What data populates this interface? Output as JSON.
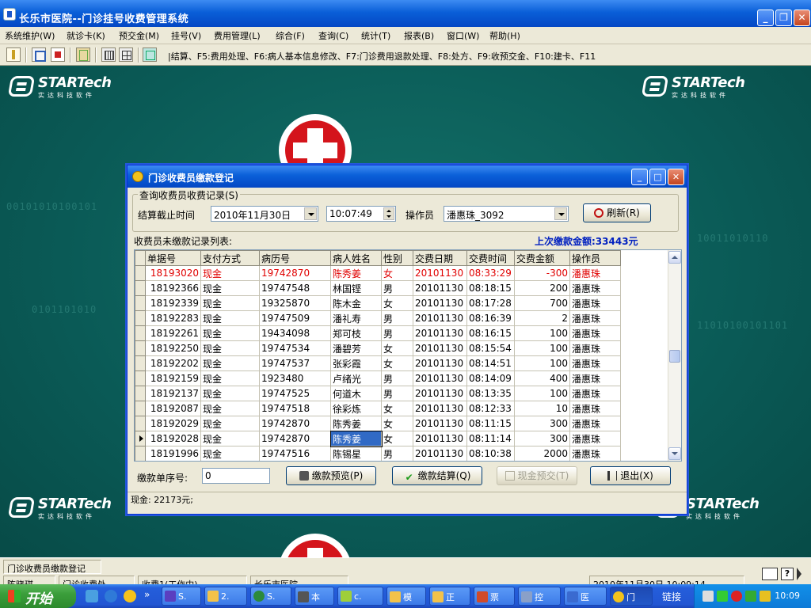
{
  "app": {
    "title": "长乐市医院--门诊挂号收费管理系统",
    "min_label": "_",
    "max_label": "❐",
    "close_label": "✕"
  },
  "menu": [
    "系统维护(W)",
    "就诊卡(K)",
    "预交金(M)",
    "挂号(V)",
    "费用管理(L)",
    "综合(F)",
    "查询(C)",
    "统计(T)",
    "报表(B)",
    "窗口(W)",
    "帮助(H)"
  ],
  "toolbar": {
    "hint": "|结算、F5:费用处理、F6:病人基本信息修改、F7:门诊费用退款处理、F8:处方、F9:收预交金、F10:建卡、F11"
  },
  "brand": {
    "name": "STARTech",
    "subtitle": "实达科技软件"
  },
  "background": {
    "binary_line_1": "00101010100101",
    "binary_line_2": "0101101010",
    "binary_line_3": "10011010110",
    "binary_line_4": "11010100101101"
  },
  "dialog": {
    "title": "门诊收费员缴款登记",
    "min_label": "_",
    "max_label": "□",
    "close_label": "✕",
    "query_group_label": "查询收费员收费记录(S)",
    "cutoff_label": "结算截止时间",
    "cutoff_date": "2010年11月30日",
    "cutoff_time": "10:07:49",
    "operator_label": "操作员",
    "operator_value": "潘惠珠_3092",
    "refresh_label": "刷新(R)",
    "list_label": "收费员未缴款记录列表:",
    "last_payment_label": "上次缴款金额:33443元",
    "payment_no_label": "缴款单序号:",
    "payment_no_value": "0",
    "preview_button": "缴款预览(P)",
    "settle_button": "缴款结算(Q)",
    "cash_preview_button": "现金预交(T)",
    "exit_button": "退出(X)",
    "summary": "现金: 22173元;"
  },
  "grid": {
    "columns": [
      "单据号",
      "支付方式",
      "病历号",
      "病人姓名",
      "性别",
      "交费日期",
      "交费时间",
      "交费金额",
      "操作员"
    ],
    "rows": [
      [
        "18193020",
        "现金",
        "19742870",
        "陈秀姜",
        "女",
        "20101130",
        "08:33:29",
        "-300",
        "潘惠珠"
      ],
      [
        "18192366",
        "现金",
        "19747548",
        "林国铿",
        "男",
        "20101130",
        "08:18:15",
        "200",
        "潘惠珠"
      ],
      [
        "18192339",
        "现金",
        "19325870",
        "陈木金",
        "女",
        "20101130",
        "08:17:28",
        "700",
        "潘惠珠"
      ],
      [
        "18192283",
        "现金",
        "19747509",
        "潘礼寿",
        "男",
        "20101130",
        "08:16:39",
        "2",
        "潘惠珠"
      ],
      [
        "18192261",
        "现金",
        "19434098",
        "郑可枝",
        "男",
        "20101130",
        "08:16:15",
        "100",
        "潘惠珠"
      ],
      [
        "18192250",
        "现金",
        "19747534",
        "潘碧芳",
        "女",
        "20101130",
        "08:15:54",
        "100",
        "潘惠珠"
      ],
      [
        "18192202",
        "现金",
        "19747537",
        "张彩霞",
        "女",
        "20101130",
        "08:14:51",
        "100",
        "潘惠珠"
      ],
      [
        "18192159",
        "现金",
        "1923480",
        "卢绪光",
        "男",
        "20101130",
        "08:14:09",
        "400",
        "潘惠珠"
      ],
      [
        "18192137",
        "现金",
        "19747525",
        "何道木",
        "男",
        "20101130",
        "08:13:35",
        "100",
        "潘惠珠"
      ],
      [
        "18192087",
        "现金",
        "19747518",
        "徐彩炼",
        "女",
        "20101130",
        "08:12:33",
        "10",
        "潘惠珠"
      ],
      [
        "18192029",
        "现金",
        "19742870",
        "陈秀姜",
        "女",
        "20101130",
        "08:11:15",
        "300",
        "潘惠珠"
      ],
      [
        "18192028",
        "现金",
        "19742870",
        "陈秀姜",
        "女",
        "20101130",
        "08:11:14",
        "300",
        "潘惠珠"
      ],
      [
        "18191996",
        "现金",
        "19747516",
        "陈锡星",
        "男",
        "20101130",
        "08:10:38",
        "2000",
        "潘惠珠"
      ]
    ]
  },
  "statusbar": {
    "panel1": "门诊收费员缴款登记",
    "panel2": "陈晓琪",
    "panel3": "门诊收费处",
    "panel4": "收费1(工作中)",
    "panel5": "长乐市医院",
    "panel6": "2010年11月30日 10:09:14"
  },
  "taskbar": {
    "start_label": "开始",
    "more_label": "»",
    "tasks": [
      "S.",
      "2.",
      "S.",
      "本",
      "c.",
      "模",
      "正",
      "票",
      "控",
      "医",
      "门"
    ],
    "links_label": "链接",
    "clock": "10:09"
  },
  "colors": {
    "titlebar": "#0a5fd8",
    "desktop": "#0a5a56",
    "negative_row": "#e00000",
    "last_payment": "#0020c0"
  }
}
